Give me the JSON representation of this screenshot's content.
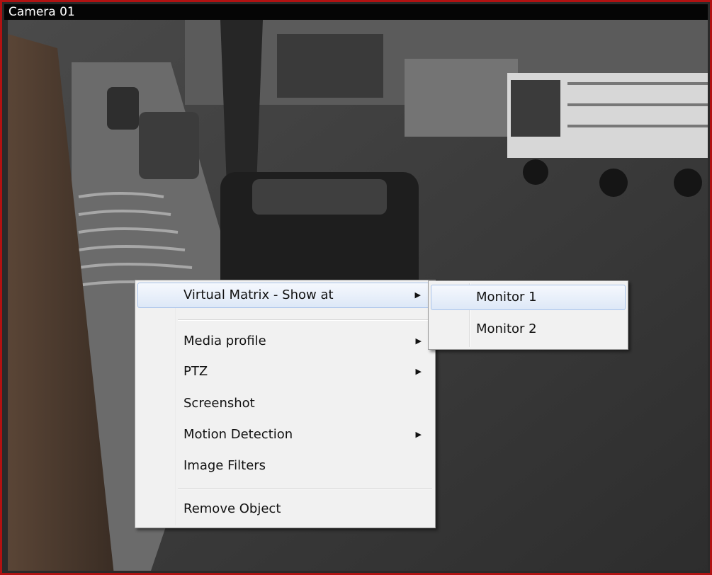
{
  "camera": {
    "title": "Camera 01"
  },
  "context_menu": {
    "items": [
      {
        "label": "Virtual Matrix - Show at",
        "submenu": true
      },
      {
        "label": "Media profile",
        "submenu": true
      },
      {
        "label": "PTZ",
        "submenu": true
      },
      {
        "label": "Screenshot",
        "submenu": false
      },
      {
        "label": "Motion Detection",
        "submenu": true
      },
      {
        "label": "Image Filters",
        "submenu": false
      },
      {
        "label": "Remove Object",
        "submenu": false
      }
    ]
  },
  "submenu": {
    "items": [
      {
        "label": "Monitor 1"
      },
      {
        "label": "Monitor 2"
      }
    ]
  },
  "colors": {
    "frame_border": "#b11212",
    "menu_bg": "#f1f1f1",
    "highlight": "#dde8f7"
  },
  "icons": {
    "submenu_arrow": "triangle-right-icon"
  }
}
